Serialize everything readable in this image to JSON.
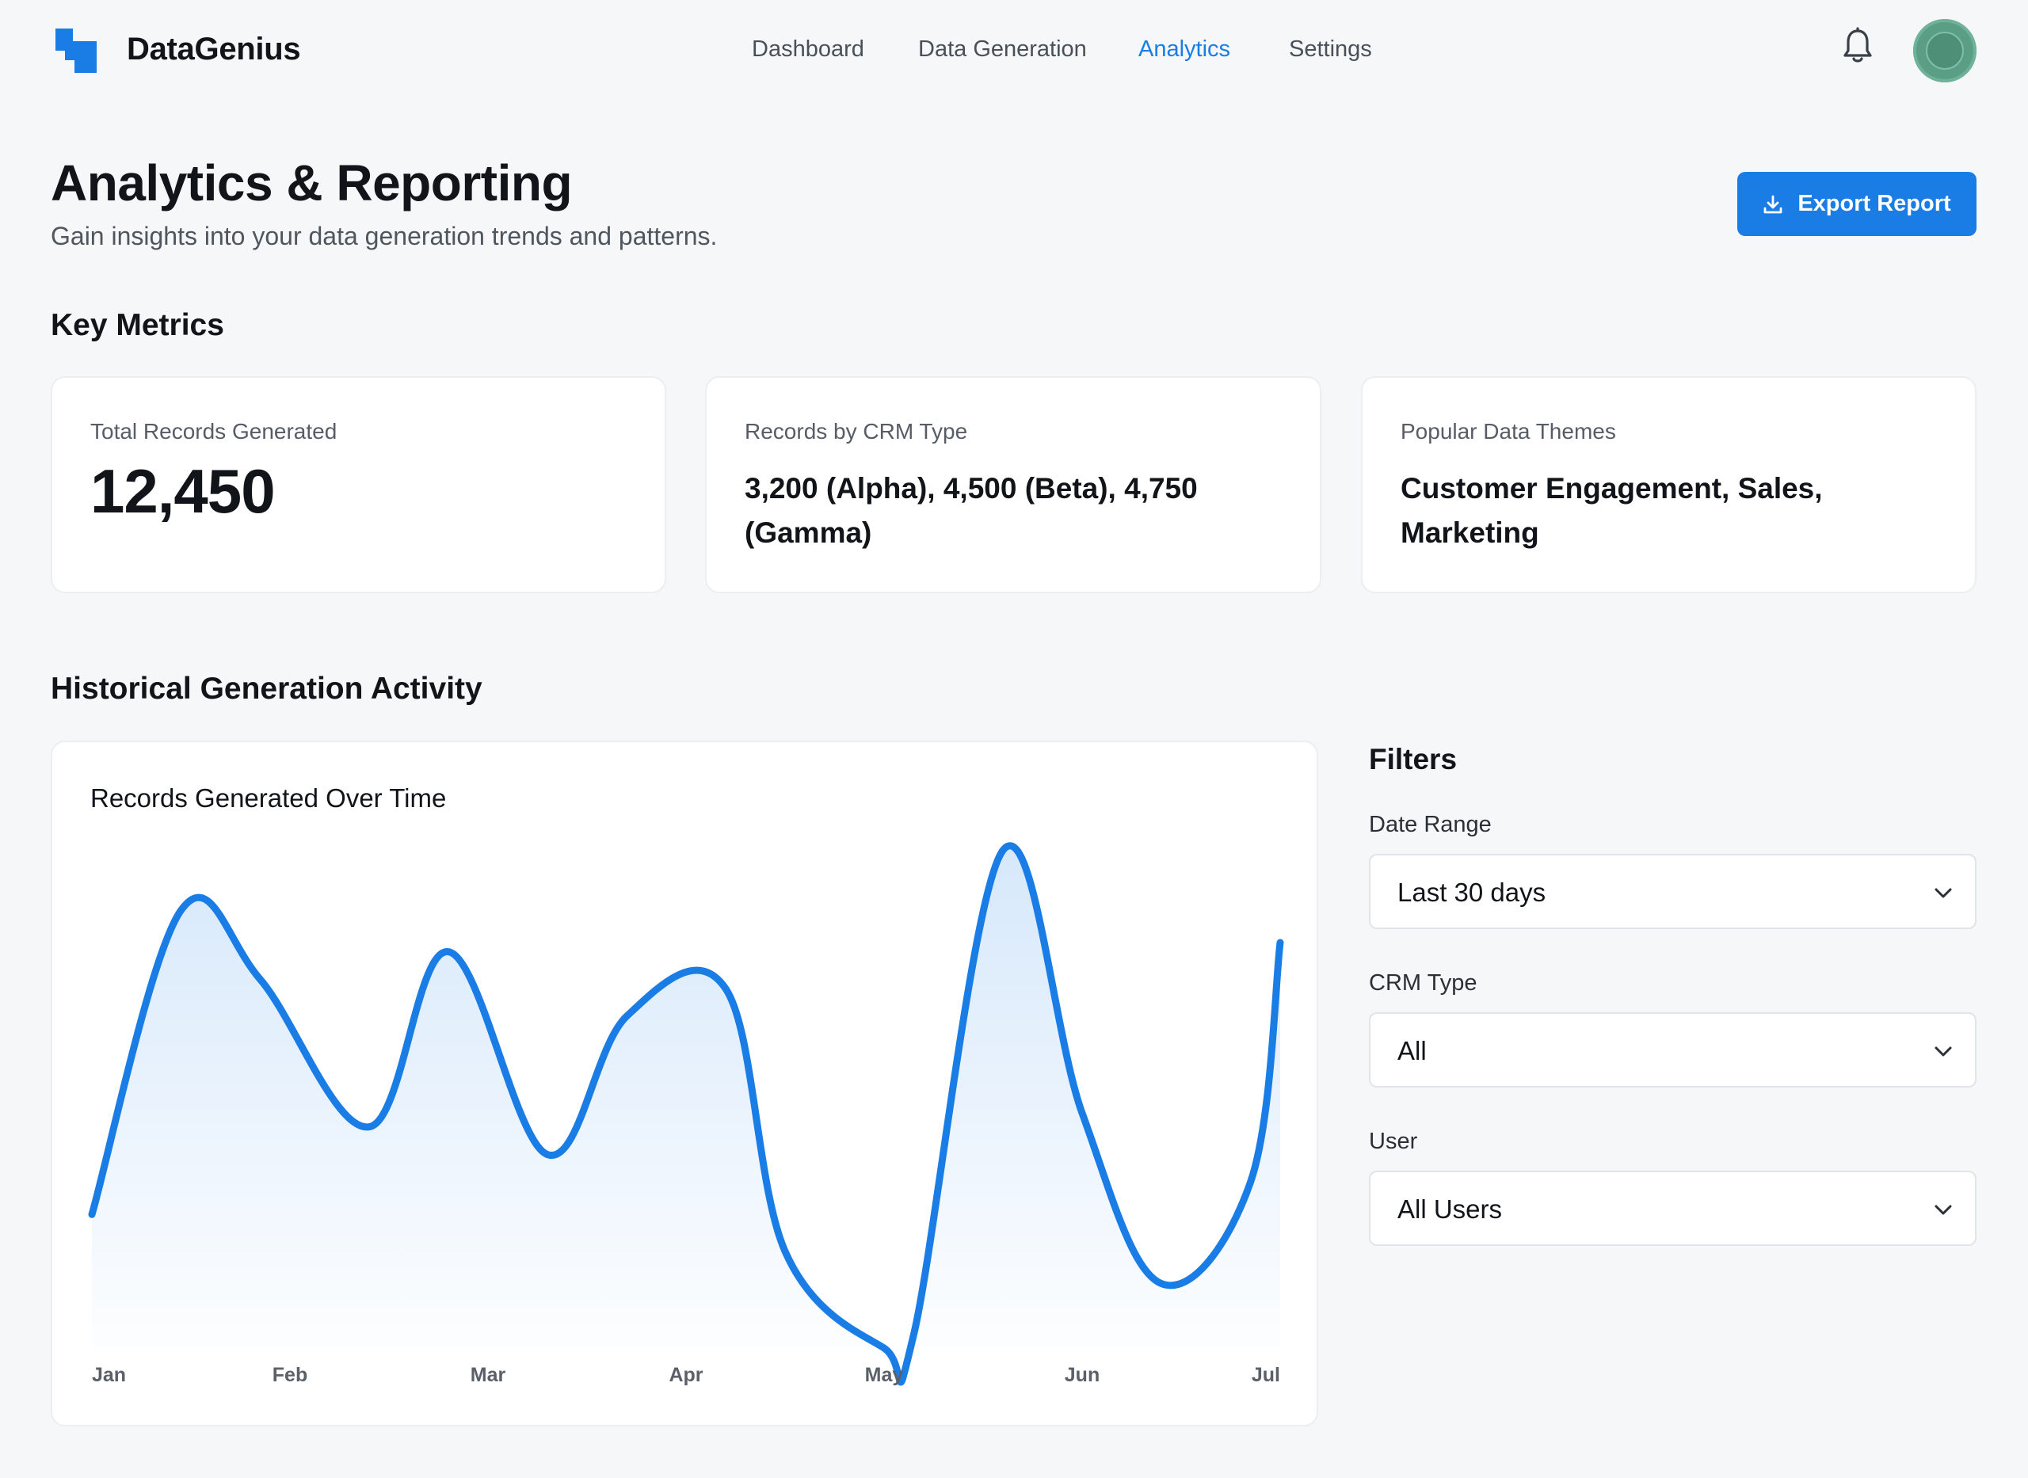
{
  "app": {
    "brand": "DataGenius"
  },
  "nav": {
    "items": [
      {
        "label": "Dashboard",
        "active": false
      },
      {
        "label": "Data Generation",
        "active": false
      },
      {
        "label": "Analytics",
        "active": true
      },
      {
        "label": "Settings",
        "active": false
      }
    ]
  },
  "header_icons": [
    "bell-icon",
    "avatar"
  ],
  "page": {
    "title": "Analytics & Reporting",
    "subtitle": "Gain insights into your data generation trends and patterns.",
    "export_label": "Export Report"
  },
  "key_metrics": {
    "heading": "Key Metrics",
    "cards": [
      {
        "label": "Total Records Generated",
        "value": "12,450"
      },
      {
        "label": "Records by CRM Type",
        "value": "3,200 (Alpha), 4,500 (Beta), 4,750 (Gamma)"
      },
      {
        "label": "Popular Data Themes",
        "value": "Customer Engagement, Sales, Marketing"
      }
    ]
  },
  "history": {
    "heading": "Historical Generation Activity",
    "chart_title": "Records Generated Over Time"
  },
  "chart_data": {
    "type": "area",
    "title": "Records Generated Over Time",
    "xlabel": "",
    "ylabel": "",
    "x_labels": [
      "Jan",
      "Feb",
      "Mar",
      "Apr",
      "May",
      "Jun",
      "Jul"
    ],
    "x": [
      0,
      0.45,
      0.85,
      1.4,
      1.8,
      2.3,
      2.7,
      3.2,
      3.5,
      4.0,
      4.15,
      4.6,
      5.0,
      5.4,
      5.85,
      6.0
    ],
    "values": [
      29,
      95,
      80,
      48,
      86,
      42,
      72,
      78,
      21,
      0,
      3,
      108,
      51,
      14,
      36,
      88
    ],
    "ylim": [
      0,
      110
    ],
    "grid": false,
    "legend": "none",
    "colors": {
      "line": "#1a7de6",
      "fill_top": "#d6e8fb",
      "fill_bottom": "#ffffff"
    }
  },
  "filters": {
    "title": "Filters",
    "fields": [
      {
        "label": "Date Range",
        "value": "Last 30 days"
      },
      {
        "label": "CRM Type",
        "value": "All"
      },
      {
        "label": "User",
        "value": "All Users"
      }
    ]
  },
  "theme": {
    "accent": "#1a7de6",
    "background": "#f6f7f9",
    "card": "#ffffff"
  }
}
